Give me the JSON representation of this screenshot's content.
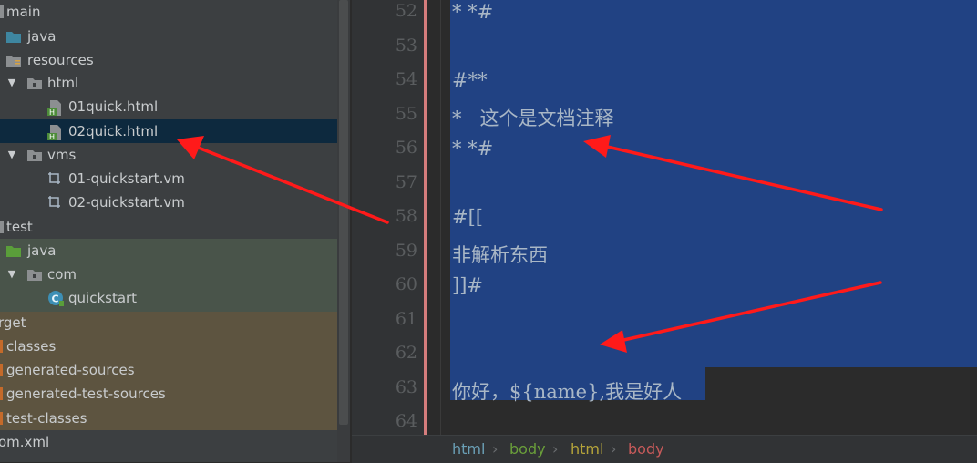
{
  "tree": {
    "items": [
      {
        "label": "main"
      },
      {
        "label": "java"
      },
      {
        "label": "resources"
      },
      {
        "label": "html"
      },
      {
        "label": "01quick.html"
      },
      {
        "label": "02quick.html"
      },
      {
        "label": "vms"
      },
      {
        "label": "01-quickstart.vm"
      },
      {
        "label": "02-quickstart.vm"
      },
      {
        "label": "test"
      },
      {
        "label": "java"
      },
      {
        "label": "com"
      },
      {
        "label": "quickstart"
      },
      {
        "label": "rget"
      },
      {
        "label": "classes"
      },
      {
        "label": "generated-sources"
      },
      {
        "label": "generated-test-sources"
      },
      {
        "label": "test-classes"
      },
      {
        "label": "om.xml"
      }
    ],
    "expanded_arrow": "▼",
    "html_badge": "H",
    "class_badge": "C"
  },
  "editor": {
    "line_numbers": [
      "52",
      "53",
      "54",
      "55",
      "56",
      "57",
      "58",
      "59",
      "60",
      "61",
      "62",
      "63",
      "64"
    ],
    "lines": [
      "* *#",
      "",
      "#**",
      "*   这个是文档注释",
      "* *#",
      "",
      "#[[",
      "非解析东西",
      "]]#",
      "",
      "",
      "你好，${name},我是好人",
      ""
    ]
  },
  "breadcrumb": {
    "items": [
      "html",
      "body",
      "html",
      "body"
    ],
    "separator": "›"
  },
  "colors": {
    "tree_bg": "#3c3f41",
    "selection": "#214283",
    "tree_selected": "#0d293e",
    "annotation": "#ff1a1a"
  }
}
